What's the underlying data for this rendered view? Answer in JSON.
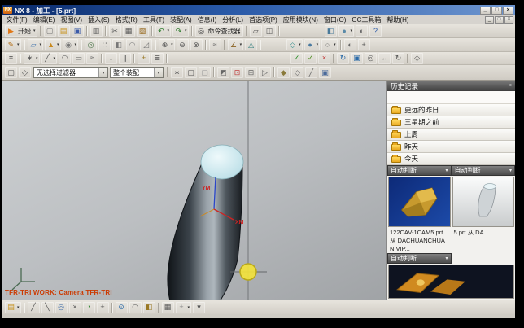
{
  "window": {
    "title": "NX 8 - 加工 - [5.prt]",
    "logo": "NX",
    "buttons": {
      "min": "_",
      "max": "□",
      "close": "×"
    }
  },
  "mdi": {
    "min": "_",
    "max": "□",
    "close": "×"
  },
  "menu": [
    "文件(F)",
    "编辑(E)",
    "视图(V)",
    "插入(S)",
    "格式(R)",
    "工具(T)",
    "装配(A)",
    "信息(I)",
    "分析(L)",
    "首选项(P)",
    "应用模块(N)",
    "窗口(O)",
    "GC工具箱",
    "帮助(H)"
  ],
  "toolbars": {
    "row1": [
      {
        "n": "start-button",
        "g": "▶",
        "c": "#e07818",
        "label": "开始",
        "dd": true
      },
      {
        "sep": true
      },
      {
        "n": "new-file-icon",
        "g": "▢",
        "c": "#777"
      },
      {
        "n": "open-file-icon",
        "g": "▤",
        "c": "#c8921a"
      },
      {
        "n": "save-icon",
        "g": "▣",
        "c": "#3a5aa8"
      },
      {
        "sep": true
      },
      {
        "n": "print-icon",
        "g": "▥",
        "c": "#666"
      },
      {
        "sep": true
      },
      {
        "n": "cut-icon",
        "g": "✂",
        "c": "#555"
      },
      {
        "n": "copy-icon",
        "g": "▦",
        "c": "#555"
      },
      {
        "n": "paste-icon",
        "g": "▧",
        "c": "#996c22"
      },
      {
        "sep": true
      },
      {
        "n": "undo-icon",
        "g": "↶",
        "c": "#2a7a2a",
        "dd": true
      },
      {
        "n": "redo-icon",
        "g": "↷",
        "c": "#2a7a2a",
        "dd": true
      },
      {
        "sep": true
      },
      {
        "n": "command-finder-button",
        "g": "◎",
        "c": "#444",
        "label": "命令查找器"
      },
      {
        "sep": true
      },
      {
        "n": "new-window-icon",
        "g": "▱",
        "c": "#555"
      },
      {
        "n": "cascade-windows-icon",
        "g": "◫",
        "c": "#555"
      },
      {
        "sep": true
      },
      {
        "gap": 52
      },
      {
        "n": "split-screen-icon",
        "g": "◧",
        "c": "#4a7a9a"
      },
      {
        "n": "display-mode-icon",
        "g": "●",
        "c": "#5a8aa8",
        "dd": true
      },
      {
        "n": "show-hide-icon",
        "g": "◐",
        "c": "#666"
      },
      {
        "n": "help-icon",
        "g": "?",
        "c": "#2a5aa8"
      }
    ],
    "row2": [
      {
        "n": "sketch-icon",
        "g": "✎",
        "c": "#b06a10",
        "dd": true
      },
      {
        "sep": true
      },
      {
        "n": "datum-plane-icon",
        "g": "▱",
        "c": "#4a7ab0",
        "dd": true
      },
      {
        "n": "extrude-icon",
        "g": "▲",
        "c": "#c8881c",
        "dd": true
      },
      {
        "n": "revolve-icon",
        "g": "◉",
        "c": "#777",
        "dd": true
      },
      {
        "sep": true
      },
      {
        "n": "hole-icon",
        "g": "◎",
        "c": "#3a6a3a"
      },
      {
        "n": "pattern-feature-icon",
        "g": "∷",
        "c": "#555"
      },
      {
        "n": "shell-icon",
        "g": "◧",
        "c": "#777"
      },
      {
        "n": "edge-blend-icon",
        "g": "◠",
        "c": "#777"
      },
      {
        "n": "chamfer-icon",
        "g": "◿",
        "c": "#777"
      },
      {
        "sep": true
      },
      {
        "n": "unite-icon",
        "g": "⊕",
        "c": "#555",
        "dd": true
      },
      {
        "n": "subtract-icon",
        "g": "⊖",
        "c": "#555"
      },
      {
        "n": "intersect-icon",
        "g": "⊗",
        "c": "#555"
      },
      {
        "sep": true
      },
      {
        "n": "sweep-icon",
        "g": "≈",
        "c": "#555"
      },
      {
        "sep": true
      },
      {
        "n": "measure-icon",
        "g": "∠",
        "c": "#8a6222",
        "dd": true
      },
      {
        "n": "deviation-icon",
        "g": "△",
        "c": "#2a7a7a"
      },
      {
        "sep": true
      },
      {
        "gap": 28
      },
      {
        "n": "view-orient-icon",
        "g": "◇",
        "c": "#2a8a8a",
        "dd": true
      },
      {
        "n": "rendering-style-icon",
        "g": "●",
        "c": "#4a7aa0",
        "dd": true
      },
      {
        "n": "wireframe-icon",
        "g": "○",
        "c": "#666",
        "dd": true
      },
      {
        "sep": true
      },
      {
        "n": "show-hide-objects-icon",
        "g": "◐",
        "c": "#666"
      },
      {
        "n": "move-object-icon",
        "g": "+",
        "c": "#555"
      }
    ],
    "row3": [
      {
        "n": "menu-toggle-icon",
        "g": "≡",
        "c": "#444"
      },
      {
        "sep": true
      },
      {
        "n": "point-icon",
        "g": "∗",
        "c": "#555",
        "dd": true
      },
      {
        "n": "line-icon",
        "g": "╱",
        "c": "#555",
        "dd": true
      },
      {
        "n": "arc-icon",
        "g": "◠",
        "c": "#555"
      },
      {
        "n": "rectangle-icon",
        "g": "▭",
        "c": "#555"
      },
      {
        "n": "spline-icon",
        "g": "≈",
        "c": "#555"
      },
      {
        "sep": true
      },
      {
        "n": "project-curve-icon",
        "g": "↓",
        "c": "#555"
      },
      {
        "n": "offset-curve-icon",
        "g": "∥",
        "c": "#555"
      },
      {
        "sep": true
      },
      {
        "n": "wcs-icon",
        "g": "+",
        "c": "#997722"
      },
      {
        "n": "layer-settings-icon",
        "g": "≣",
        "c": "#555"
      },
      {
        "sep": true
      },
      {
        "gap": 148
      },
      {
        "n": "ok-check-icon",
        "g": "✓",
        "c": "#1a8a1a"
      },
      {
        "n": "apply-check-icon",
        "g": "✓",
        "c": "#4a8a1a"
      },
      {
        "n": "cancel-icon",
        "g": "×",
        "c": "#c03030"
      },
      {
        "sep": true
      },
      {
        "n": "refresh-icon",
        "g": "↻",
        "c": "#2a6aa8"
      },
      {
        "n": "fit-view-icon",
        "g": "▣",
        "c": "#2a6aa8"
      },
      {
        "n": "zoom-icon",
        "g": "◎",
        "c": "#555"
      },
      {
        "n": "pan-icon",
        "g": "↔",
        "c": "#555"
      },
      {
        "n": "rotate-view-icon",
        "g": "↻",
        "c": "#555"
      },
      {
        "sep": true
      },
      {
        "n": "perspective-icon",
        "g": "◇",
        "c": "#555"
      }
    ],
    "selbar_lead": [
      {
        "n": "selection-type-icon",
        "g": "▢",
        "c": "#555"
      },
      {
        "n": "selection-scope-icon",
        "g": "◇",
        "c": "#555"
      }
    ],
    "selbar_icons": [
      {
        "sep": true
      },
      {
        "n": "snap-point-toggle-icon",
        "g": "∗",
        "c": "#555"
      },
      {
        "n": "select-all-icon",
        "g": "▢",
        "c": "#555"
      },
      {
        "n": "deselect-all-icon",
        "g": "▢",
        "c": "#999"
      },
      {
        "sep": true
      },
      {
        "n": "highlight-icon",
        "g": "◩",
        "c": "#666"
      },
      {
        "n": "inside-window-icon",
        "g": "⊡",
        "c": "#c04040"
      },
      {
        "n": "crossing-window-icon",
        "g": "⊞",
        "c": "#666"
      },
      {
        "n": "polygon-select-icon",
        "g": "▷",
        "c": "#666"
      },
      {
        "sep": true
      },
      {
        "n": "solid-body-filter-icon",
        "g": "◆",
        "c": "#8a7a3a"
      },
      {
        "n": "face-filter-icon",
        "g": "◇",
        "c": "#666"
      },
      {
        "n": "edge-filter-icon",
        "g": "╱",
        "c": "#666"
      },
      {
        "n": "component-filter-icon",
        "g": "▣",
        "c": "#4a6a9a"
      }
    ],
    "bottom": [
      {
        "n": "create-folder-icon",
        "g": "▤",
        "c": "#c8921a",
        "dd": true
      },
      {
        "sep": true
      },
      {
        "n": "snap-endpoint-icon",
        "g": "╱",
        "c": "#555"
      },
      {
        "n": "snap-midpoint-icon",
        "g": "╲",
        "c": "#555"
      },
      {
        "n": "snap-center-icon",
        "g": "◎",
        "c": "#3a6aa8"
      },
      {
        "n": "snap-intersection-icon",
        "g": "×",
        "c": "#555"
      },
      {
        "n": "snap-quadrant-icon",
        "g": "◔",
        "c": "#3a8a3a"
      },
      {
        "n": "snap-existing-point-icon",
        "g": "+",
        "c": "#555"
      },
      {
        "sep": true
      },
      {
        "n": "enable-snap-icon",
        "g": "⊙",
        "c": "#2a6aa8"
      },
      {
        "n": "curve-snap-icon",
        "g": "◠",
        "c": "#555"
      },
      {
        "n": "surface-snap-icon",
        "g": "◧",
        "c": "#997722"
      },
      {
        "sep": true
      },
      {
        "n": "grid-icon",
        "g": "▦",
        "c": "#555"
      },
      {
        "n": "wcs-dynamics-icon",
        "g": "+",
        "c": "#888",
        "dd": true
      },
      {
        "n": "more-snap-options-icon",
        "g": "▾",
        "c": "#555"
      }
    ]
  },
  "selection_bar": {
    "filter": "无选择过滤器",
    "scope": "整个装配"
  },
  "viewport": {
    "status_text": "TFR-TRI WORK: Camera TFR-TRI",
    "labels": {
      "xm": "XM",
      "ym": "YM"
    }
  },
  "history": {
    "title": "历史记录",
    "close": "×",
    "folders": [
      "更远的昨日",
      "三星期之前",
      "上周",
      "昨天",
      "今天"
    ],
    "left_combo": "自动判断",
    "right_combo": "自动判断",
    "bottom_combo": "自动判断",
    "items": [
      {
        "label": "122CAV-1CAM5.prt 从 DACHUANCHUAN.VIP..."
      },
      {
        "label": "5.prt 从 DA..."
      }
    ]
  }
}
